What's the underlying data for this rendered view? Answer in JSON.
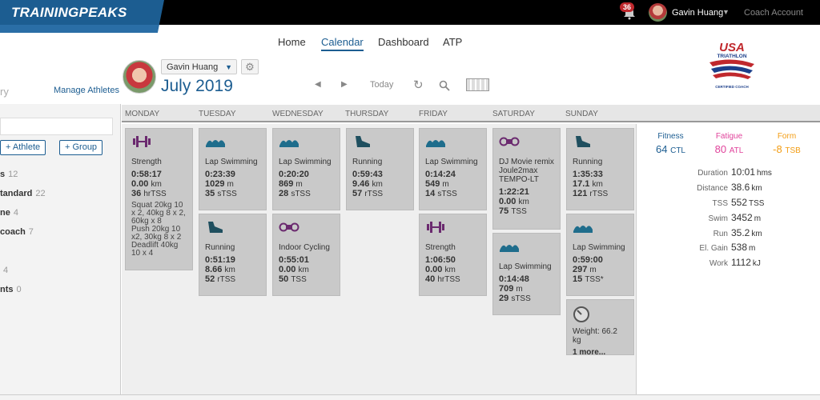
{
  "brand": {
    "logo": "TRAININGPEAKS"
  },
  "topbar": {
    "notifications": "36",
    "user": "Gavin Huang",
    "coach_account": "Coach Account",
    "caret": "▼"
  },
  "nav": {
    "home": "Home",
    "calendar": "Calendar",
    "dashboard": "Dashboard",
    "atp": "ATP"
  },
  "athlete": {
    "selected": "Gavin Huang",
    "month": "July 2019"
  },
  "toolbar": {
    "today": "Today"
  },
  "left": {
    "partial_title": "ry",
    "manage": "Manage Athletes",
    "add_athlete": "+ Athlete",
    "add_group": "+ Group"
  },
  "sidebar_items": [
    {
      "label": "s",
      "count": "12"
    },
    {
      "label": "tandard",
      "count": "22"
    },
    {
      "label": "ne",
      "count": "4"
    },
    {
      "label": "coach",
      "count": "7"
    },
    {
      "label": "",
      "count": "4"
    },
    {
      "label": "nts",
      "count": "0"
    }
  ],
  "days": [
    "MONDAY",
    "TUESDAY",
    "WEDNESDAY",
    "THURSDAY",
    "FRIDAY",
    "SATURDAY",
    "SUNDAY"
  ],
  "workouts": {
    "mon_strength": {
      "icon": "strength-icon",
      "title": "Strength",
      "dur": "0:58:17",
      "dist": "0.00",
      "dist_u": "km",
      "tss": "36",
      "tss_u": "hrTSS",
      "notes": [
        "Squat 20kg 10",
        "x 2, 40kg 8 x 2,",
        "60kg x 8",
        "Push 20kg 10",
        "x2, 30kg 8 x 2",
        "Deadlift 40kg",
        "10 x 4"
      ]
    },
    "tue_swim": {
      "icon": "swim-icon",
      "title": "Lap Swimming",
      "dur": "0:23:39",
      "dist": "1029",
      "dist_u": "m",
      "tss": "35",
      "tss_u": "sTSS"
    },
    "tue_run": {
      "icon": "run-icon",
      "title": "Running",
      "dur": "0:51:19",
      "dist": "8.66",
      "dist_u": "km",
      "tss": "52",
      "tss_u": "rTSS"
    },
    "wed_swim": {
      "icon": "swim-icon",
      "title": "Lap Swimming",
      "dur": "0:20:20",
      "dist": "869",
      "dist_u": "m",
      "tss": "28",
      "tss_u": "sTSS"
    },
    "wed_bike": {
      "icon": "bike-icon",
      "title": "Indoor Cycling",
      "dur": "0:55:01",
      "dist": "0.00",
      "dist_u": "km",
      "tss": "50",
      "tss_u": "TSS"
    },
    "thu_run": {
      "icon": "run-icon",
      "title": "Running",
      "dur": "0:59:43",
      "dist": "9.46",
      "dist_u": "km",
      "tss": "57",
      "tss_u": "rTSS"
    },
    "fri_swim": {
      "icon": "swim-icon",
      "title": "Lap Swimming",
      "dur": "0:14:24",
      "dist": "549",
      "dist_u": "m",
      "tss": "14",
      "tss_u": "sTSS"
    },
    "fri_strength": {
      "icon": "strength-icon",
      "title": "Strength",
      "dur": "1:06:50",
      "dist": "0.00",
      "dist_u": "km",
      "tss": "40",
      "tss_u": "hrTSS"
    },
    "sat_bike": {
      "icon": "bike-icon",
      "title": "DJ Movie remix Joule2max TEMPO-LT",
      "dur": "1:22:21",
      "dist": "0.00",
      "dist_u": "km",
      "tss": "75",
      "tss_u": "TSS"
    },
    "sat_swim": {
      "icon": "swim-icon",
      "title": "Lap Swimming",
      "dur": "0:14:48",
      "dist": "709",
      "dist_u": "m",
      "tss": "29",
      "tss_u": "sTSS"
    },
    "sun_run": {
      "icon": "run-icon",
      "title": "Running",
      "dur": "1:35:33",
      "dist": "17.1",
      "dist_u": "km",
      "tss": "121",
      "tss_u": "rTSS"
    },
    "sun_swim": {
      "icon": "swim-icon",
      "title": "Lap Swimming",
      "dur": "0:59:00",
      "dist": "297",
      "dist_u": "m",
      "tss": "15",
      "tss_u": "TSS*"
    },
    "sun_metrics": {
      "icon": "gauge-icon",
      "weight": "Weight: 66.2",
      "weight_u": "kg",
      "more": "1 more..."
    }
  },
  "summary": {
    "fitness": {
      "label": "Fitness",
      "value": "64",
      "unit": "CTL",
      "color": "#1c5d91"
    },
    "fatigue": {
      "label": "Fatigue",
      "value": "80",
      "unit": "ATL",
      "color": "#e0439b"
    },
    "form": {
      "label": "Form",
      "value": "-8",
      "unit": "TSB",
      "color": "#f39c12"
    },
    "rows": [
      {
        "label": "Duration",
        "value": "10:01",
        "unit": "hms"
      },
      {
        "label": "Distance",
        "value": "38.6",
        "unit": "km"
      },
      {
        "label": "TSS",
        "value": "552",
        "unit": "TSS"
      },
      {
        "label": "Swim",
        "value": "3452",
        "unit": "m"
      },
      {
        "label": "Run",
        "value": "35.2",
        "unit": "km"
      },
      {
        "label": "El. Gain",
        "value": "538",
        "unit": "m"
      },
      {
        "label": "Work",
        "value": "1112",
        "unit": "kJ"
      }
    ]
  },
  "usat": {
    "line1": "USA",
    "line2": "TRIATHLON",
    "line3": "CERTIFIED COACH"
  }
}
